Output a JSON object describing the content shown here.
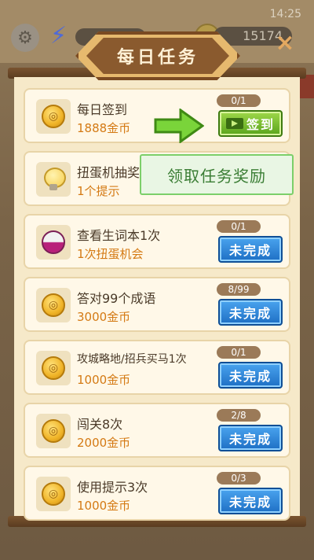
{
  "status": {
    "time": "14:25"
  },
  "topbar": {
    "coins": "15174"
  },
  "panel": {
    "title": "每日任务",
    "close_label": "×"
  },
  "tooltip": "领取任务奖励",
  "tasks": [
    {
      "name": "每日签到",
      "reward": "1888金币",
      "progress": "0/1",
      "button": "签到",
      "state": "claim",
      "icon": "coin-icon"
    },
    {
      "name": "扭蛋机抽奖",
      "reward": "1个提示",
      "progress": "",
      "button": "",
      "state": "hidden",
      "icon": "bulb-icon"
    },
    {
      "name": "查看生词本1次",
      "reward": "1次扭蛋机会",
      "progress": "0/1",
      "button": "未完成",
      "state": "incomplete",
      "icon": "capsule-icon"
    },
    {
      "name": "答对99个成语",
      "reward": "3000金币",
      "progress": "8/99",
      "button": "未完成",
      "state": "incomplete",
      "icon": "coin-icon"
    },
    {
      "name": "攻城略地/招兵买马1次",
      "reward": "1000金币",
      "progress": "0/1",
      "button": "未完成",
      "state": "incomplete",
      "icon": "coin-icon"
    },
    {
      "name": "闯关8次",
      "reward": "2000金币",
      "progress": "2/8",
      "button": "未完成",
      "state": "incomplete",
      "icon": "coin-icon"
    },
    {
      "name": "使用提示3次",
      "reward": "1000金币",
      "progress": "0/3",
      "button": "未完成",
      "state": "incomplete",
      "icon": "coin-icon"
    }
  ],
  "colors": {
    "panel_bg": "#f6e9c9",
    "reward_text": "#d47a14",
    "button_blue": "#1e6fc4",
    "button_green": "#5aa41c",
    "tooltip_text": "#3a7d34"
  }
}
